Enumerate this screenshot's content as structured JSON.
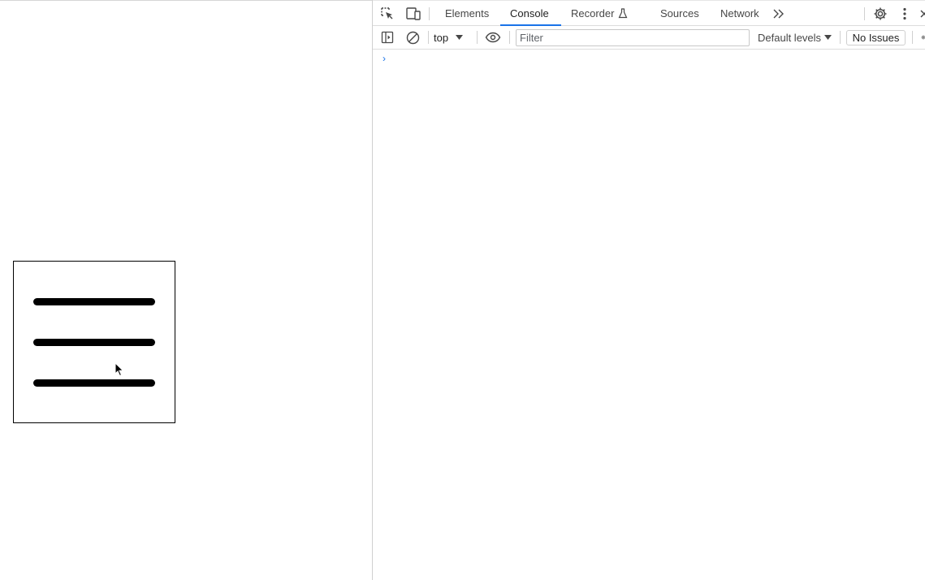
{
  "devtools": {
    "tabs": [
      {
        "label": "Elements",
        "active": false
      },
      {
        "label": "Console",
        "active": true
      },
      {
        "label": "Recorder",
        "active": false
      },
      {
        "label": "Sources",
        "active": false
      },
      {
        "label": "Network",
        "active": false
      }
    ],
    "toolbar": {
      "context": "top",
      "filter_placeholder": "Filter",
      "levels": "Default levels",
      "issues": "No Issues"
    },
    "console": {
      "prompt": "›"
    },
    "colors": {
      "accent": "#1a73e8"
    }
  },
  "page": {
    "element": "hamburger-menu-icon"
  }
}
